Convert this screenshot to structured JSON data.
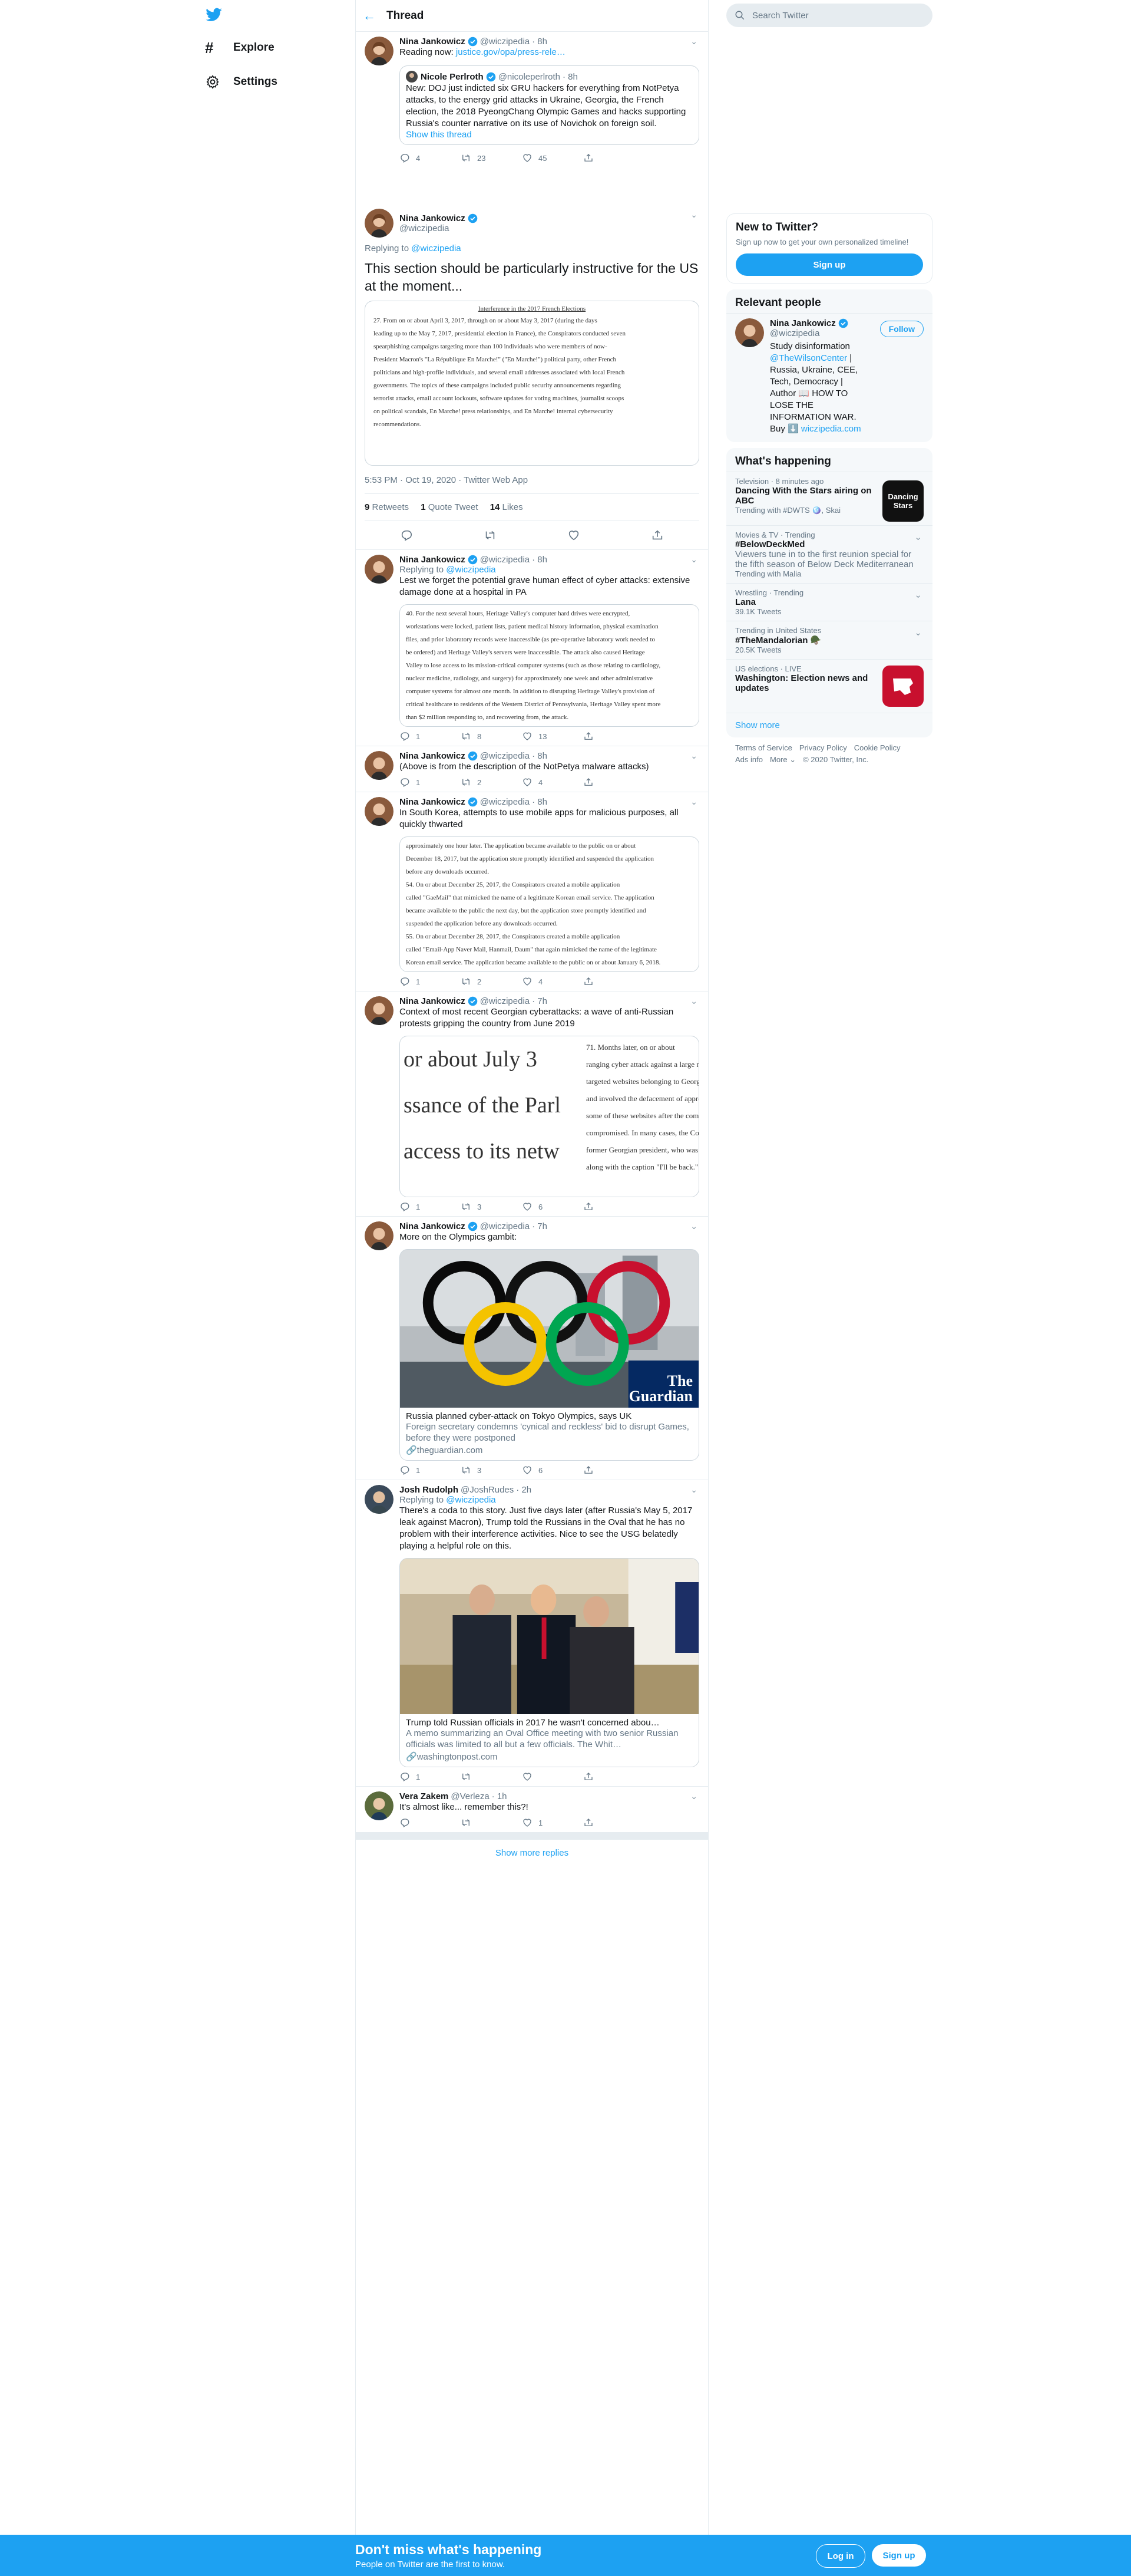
{
  "nav": {
    "explore": "Explore",
    "settings": "Settings"
  },
  "header": {
    "title": "Thread"
  },
  "search": {
    "placeholder": "Search Twitter"
  },
  "colors": {
    "accent": "#1da1f2",
    "text": "#14171a",
    "muted": "#657786",
    "border": "#e6ecf0"
  },
  "tweets": [
    {
      "name": "Nina Jankowicz",
      "handle": "@wiczipedia",
      "time": "· 8h",
      "text": "Reading now:",
      "link": "justice.gov/opa/press-rele…",
      "quote": {
        "name": "Nicole Perlroth",
        "handle": "@nicoleperlroth",
        "time": "· 8h",
        "text": "New: DOJ just indicted six GRU hackers for everything from NotPetya attacks, to the energy grid attacks in Ukraine, Georgia, the French election, the 2018 PyeongChang Olympic Games and hacks supporting Russia's counter narrative on its use of Novichok on foreign soil.",
        "show_thread": "Show this thread"
      },
      "replies": "4",
      "retweets": "23",
      "likes": "45"
    }
  ],
  "focus": {
    "name": "Nina Jankowicz",
    "handle": "@wiczipedia",
    "replying_prefix": "Replying to",
    "replying_to": "@wiczipedia",
    "text": "This section should be particularly instructive for the US at the moment...",
    "doc_heading": "Interference in the 2017 French Elections",
    "doc_lines": [
      "27.    From on or about April 3, 2017, through on or about May 3, 2017 (during the days",
      "leading up to the May 7, 2017, presidential election in France), the Conspirators conducted seven",
      "spearphishing campaigns targeting more than 100 individuals who were members of now-",
      "President Macron's \"La République En Marche!\" (\"En Marche!\") political party, other French",
      "politicians and high-profile individuals, and several email addresses associated with local French",
      "governments.  The topics of these campaigns included public security announcements regarding",
      "terrorist attacks, email account lockouts, software updates for voting machines, journalist scoops",
      "on political scandals, En Marche! press relationships, and En Marche! internal cybersecurity",
      "recommendations."
    ],
    "timestamp": "5:53 PM · Oct 19, 2020 · Twitter Web App",
    "retweets_count": "9",
    "retweets_label": "Retweets",
    "quotes_count": "1",
    "quotes_label": "Quote Tweet",
    "likes_count": "14",
    "likes_label": "Likes"
  },
  "replies": [
    {
      "name": "Nina Jankowicz",
      "handle": "@wiczipedia",
      "time": "· 8h",
      "replying_prefix": "Replying to",
      "replying_to": "@wiczipedia",
      "text": "Lest we forget the potential grave human effect of cyber attacks: extensive damage done at a hospital in PA",
      "doc_lines": [
        "40.     For the next several hours, Heritage Valley's computer hard drives were encrypted,",
        "workstations were locked, patient lists, patient medical history information, physical examination",
        "files, and prior laboratory records were inaccessible (as pre-operative laboratory work needed to",
        "be ordered) and Heritage Valley's servers were inaccessible.  The attack also caused Heritage",
        "Valley to lose access to its mission-critical computer systems (such as those relating to cardiology,",
        "nuclear medicine, radiology, and surgery) for approximately one week and other administrative",
        "computer systems for almost one month.  In addition to disrupting Heritage Valley's provision of",
        "critical healthcare to residents of the Western District of Pennsylvania, Heritage Valley spent more",
        "than $2 million responding to, and recovering from, the attack."
      ],
      "replies": "1",
      "retweets": "8",
      "likes": "13"
    },
    {
      "name": "Nina Jankowicz",
      "handle": "@wiczipedia",
      "time": "· 8h",
      "text": "(Above is from the description of the NotPetya malware attacks)",
      "replies": "1",
      "retweets": "2",
      "likes": "4"
    },
    {
      "name": "Nina Jankowicz",
      "handle": "@wiczipedia",
      "time": "· 8h",
      "text": "In South Korea, attempts to use mobile apps for malicious purposes, all quickly thwarted",
      "doc_lines": [
        "approximately one hour later.  The application became available to the public on or about",
        "December 18, 2017, but the application store promptly identified and suspended the application",
        "before any downloads occurred.",
        "54.      On or about December 25, 2017, the Conspirators created a mobile application",
        "called \"GaeMail\" that mimicked the name of a legitimate Korean email service.  The application",
        "became available to the public the next day, but the application store promptly identified and",
        "suspended the application before any downloads occurred.",
        "55.      On or about December 28, 2017, the Conspirators created a mobile application",
        "called \"Email-App Naver Mail, Hanmail, Daum\" that again mimicked the name of the legitimate",
        "Korean email service.  The application became available to the public on or about January 6, 2018."
      ],
      "replies": "1",
      "retweets": "2",
      "likes": "4"
    },
    {
      "name": "Nina Jankowicz",
      "handle": "@wiczipedia",
      "time": "· 7h",
      "text": "Context of most recent Georgian cyberattacks: a wave of anti-Russian protests gripping the country from June 2019",
      "zoom_left": [
        "or about July 3",
        "ssance of the Parl",
        "access to its netw"
      ],
      "zoom_right": [
        "71.     Months later, on or about",
        "ranging cyber attack against a large nu",
        "targeted websites belonging to Georgian",
        "and involved the defacement of approxi",
        "some of these websites after the comp",
        "compromised.  In many cases, the Comp",
        "former Georgian president, who was know",
        "along with the caption \"I'll be back.\""
      ],
      "replies": "1",
      "retweets": "3",
      "likes": "6"
    },
    {
      "name": "Nina Jankowicz",
      "handle": "@wiczipedia",
      "time": "· 7h",
      "text": "More on the Olympics gambit:",
      "card_brand": "The Guardian",
      "card_title": "Russia planned cyber-attack on Tokyo Olympics, says UK",
      "card_desc": "Foreign secretary condemns 'cynical and reckless' bid to disrupt Games, before they were postponed",
      "card_source": "theguardian.com",
      "replies": "1",
      "retweets": "3",
      "likes": "6"
    },
    {
      "name": "Josh Rudolph",
      "handle": "@JoshRudes",
      "time": "· 2h",
      "replying_prefix": "Replying to",
      "replying_to": "@wiczipedia",
      "text": "There's a coda to this story. Just five days later (after Russia's May 5, 2017 leak against Macron), Trump told the Russians in the Oval that he has no problem with their interference activities. Nice to see the USG belatedly playing a helpful role on this.",
      "card_title": "Trump told Russian officials in 2017 he wasn't concerned abou…",
      "card_desc": "A memo summarizing an Oval Office meeting with two senior Russian officials was limited to all but a few officials. The Whit…",
      "card_source": "washingtonpost.com",
      "replies": "1",
      "retweets": "",
      "likes": ""
    },
    {
      "name": "Vera Zakem",
      "handle": "@Verleza",
      "time": "· 1h",
      "text": "It's almost like... remember this?!",
      "replies": "",
      "retweets": "",
      "likes": "1"
    }
  ],
  "show_more": "Show more replies",
  "right": {
    "new_title": "New to Twitter?",
    "new_desc": "Sign up now to get your own personalized timeline!",
    "signup": "Sign up",
    "relevant_title": "Relevant people",
    "person": {
      "name": "Nina Jankowicz",
      "handle": "@wiczipedia",
      "follow": "Follow",
      "bio_pre": "Study disinformation",
      "bio_link": "@TheWilsonCenter",
      "bio_post": "| Russia, Ukraine, CEE, Tech, Democracy | Author 📖 HOW TO LOSE THE INFORMATION WAR. Buy ⬇️",
      "bio_url": "wiczipedia.com"
    },
    "happening_title": "What's happening",
    "trends": [
      {
        "cat": "Television · 8 minutes ago",
        "title": "Dancing With the Stars airing on ABC",
        "extra": "Trending with #DWTS 🪩, Skai",
        "thumb": "Dancing Stars"
      },
      {
        "cat": "Movies & TV · Trending",
        "title": "#BelowDeckMed",
        "desc": "Viewers tune in to the first reunion special for the fifth season of Below Deck Mediterranean",
        "extra": "Trending with Malia"
      },
      {
        "cat": "Wrestling · Trending",
        "title": "Lana",
        "count": "39.1K Tweets"
      },
      {
        "cat": "Trending in United States",
        "title": "#TheMandalorian 🪖",
        "count": "20.5K Tweets"
      },
      {
        "cat": "US elections · LIVE",
        "title": "Washington: Election news and updates"
      }
    ],
    "show_more": "Show more",
    "footer1": [
      "Terms of Service",
      "Privacy Policy",
      "Cookie Policy"
    ],
    "footer2": [
      "Ads info",
      "More ⌄",
      "© 2020 Twitter, Inc."
    ]
  },
  "bottom": {
    "title": "Don't miss what's happening",
    "subtitle": "People on Twitter are the first to know.",
    "login": "Log in",
    "signup": "Sign up"
  }
}
